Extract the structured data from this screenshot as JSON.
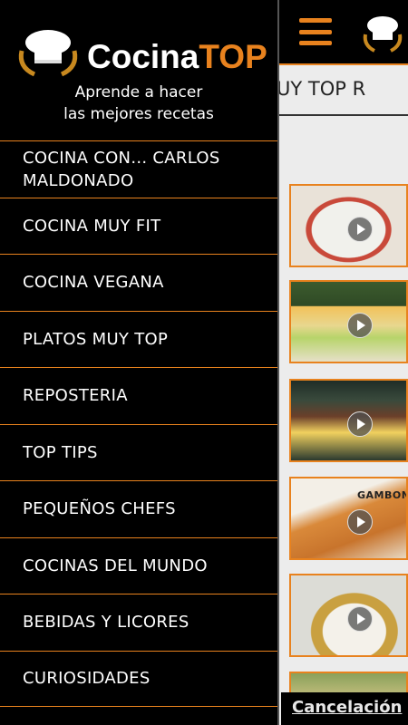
{
  "app": {
    "brand_part1": "Cocina",
    "brand_part2": "TOP",
    "tagline_line1": "Aprende a hacer",
    "tagline_line2": "las mejores recetas"
  },
  "background": {
    "tab_text": "PLATOS MUY TOP  R",
    "thumb_caption": "GAMBON",
    "cancel_label": "Cancelación"
  },
  "menu": {
    "items": [
      {
        "label": "COCINA CON... CARLOS MALDONADO"
      },
      {
        "label": "COCINA MUY FIT"
      },
      {
        "label": "COCINA VEGANA"
      },
      {
        "label": "PLATOS MUY TOP"
      },
      {
        "label": "REPOSTERIA"
      },
      {
        "label": "TOP TIPS"
      },
      {
        "label": "PEQUEÑOS CHEFS"
      },
      {
        "label": "COCINAS DEL MUNDO"
      },
      {
        "label": "BEBIDAS Y LICORES"
      },
      {
        "label": "CURIOSIDADES"
      }
    ]
  },
  "colors": {
    "accent": "#e8821e",
    "drawer_bg": "#000000",
    "text": "#ffffff"
  },
  "icons": [
    "menu-icon",
    "chef-hat-logo",
    "play-icon"
  ]
}
